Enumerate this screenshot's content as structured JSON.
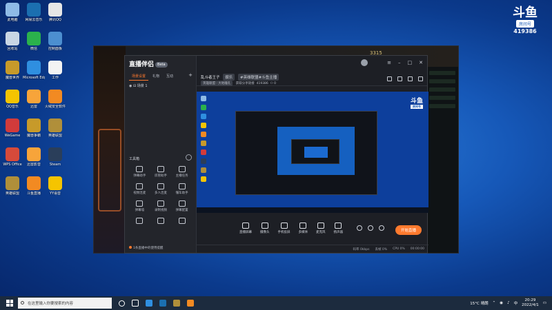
{
  "desktop": {
    "icons": [
      {
        "label": "此电脑",
        "color": "#8fbbe6"
      },
      {
        "label": "网易云音乐",
        "color": "#1b6fb0"
      },
      {
        "label": "腾讯QQ",
        "color": "#e6e6e6"
      },
      {
        "label": "回收站",
        "color": "#c9d6e4"
      },
      {
        "label": "微信",
        "color": "#2bb24c"
      },
      {
        "label": "控制面板",
        "color": "#4c8fd0"
      },
      {
        "label": "魔兽世界",
        "color": "#c79a2a"
      },
      {
        "label": "Microsoft Edge",
        "color": "#2f8fe0"
      },
      {
        "label": "工作",
        "color": "#f3f3f3"
      },
      {
        "label": "QQ音乐",
        "color": "#f5c400"
      },
      {
        "label": "迅雷",
        "color": "#f7a43a"
      },
      {
        "label": "火绒安全软件",
        "color": "#f28a22"
      },
      {
        "label": "WeGame",
        "color": "#d23b3b"
      },
      {
        "label": "魔兽争霸",
        "color": "#c79a2a"
      },
      {
        "label": "英雄联盟",
        "color": "#b08f3a"
      },
      {
        "label": "WPS Office",
        "color": "#d64a3a"
      },
      {
        "label": "迅雷影音",
        "color": "#f7a43a"
      },
      {
        "label": "Steam",
        "color": "#2a3e5a"
      },
      {
        "label": "英雄联盟",
        "color": "#b08f3a"
      },
      {
        "label": "斗鱼直播",
        "color": "#f28a22"
      },
      {
        "label": "YY语音",
        "color": "#f5c400"
      }
    ]
  },
  "douyu": {
    "mark": "斗鱼",
    "room_label": "房间号",
    "room_number": "419386"
  },
  "game": {
    "badge": "3315"
  },
  "app": {
    "title": "直播伴侣",
    "beta": "Beta",
    "left_tabs": [
      "场景设置",
      "礼物",
      "互动"
    ],
    "scene": "场景 1",
    "tools_title": "工具箱",
    "tools": [
      "弹幕助手",
      "房管助手",
      "主播任务",
      "视频连麦",
      "多人连麦",
      "懂车助手",
      "弹幕墙",
      "录制视频",
      "弹幕配置",
      "",
      "",
      ""
    ],
    "notice": "1条直播中的使用提醒",
    "room_title": "乱斗者王子",
    "room_tag": "娱乐",
    "room_subtag": "#英雄联盟#斗鱼主播",
    "room_category": "英雄联盟 · 大地瞳孔",
    "room_meta": "获取分享链接",
    "room_id": "419386",
    "room_viewers": "0",
    "toolbar": [
      "直播屏幕",
      "摄像头",
      "手机投屏",
      "多媒体",
      "麦克风",
      "扬声器"
    ],
    "go_live": "开始直播",
    "status": [
      "码率 0kbps",
      "丢帧 0%",
      "CPU 0%",
      "00:00:00"
    ]
  },
  "taskbar": {
    "search_placeholder": "在这里输入你要搜索的内容",
    "weather": "15°C 晴朗",
    "time": "20:29",
    "date": "2022/4/1",
    "lang": "中"
  }
}
